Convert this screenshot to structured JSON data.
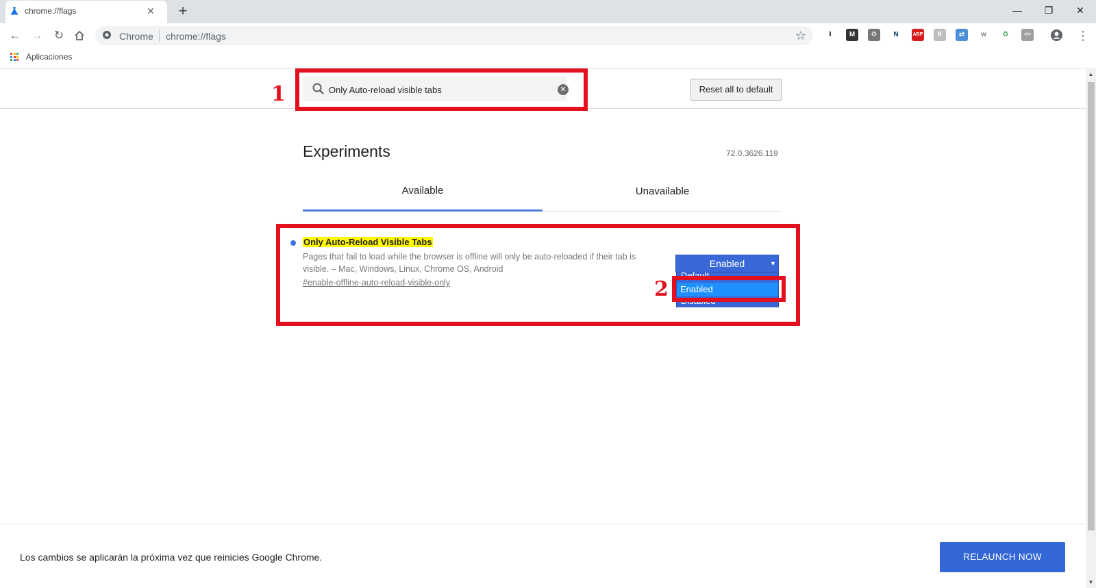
{
  "browser": {
    "tab": {
      "title": "chrome://flags",
      "favicon": "flask-icon",
      "close": "✕"
    },
    "new_tab": "+",
    "window": {
      "minimize": "—",
      "restore": "❐",
      "close": "✕"
    },
    "omnibox": {
      "site_label": "Chrome",
      "url": "chrome://flags"
    },
    "bookmarks": [
      {
        "label": "Aplicaciones",
        "icon": "apps-grid-icon"
      }
    ],
    "extensions": [
      {
        "name": "instapaper-icon",
        "glyph": "I",
        "color": "#ffffff",
        "fg": "#000000"
      },
      {
        "name": "mega-icon",
        "glyph": "M",
        "color": "#333333",
        "fg": "#ffffff"
      },
      {
        "name": "cog-extension-icon",
        "glyph": "⚙",
        "color": "#777777",
        "fg": "#ffffff"
      },
      {
        "name": "n-extension-icon",
        "glyph": "N",
        "color": "#ffffff",
        "fg": "#003a70"
      },
      {
        "name": "adblock-plus-icon",
        "glyph": "ABP",
        "color": "#d81b1b",
        "fg": "#ffffff"
      },
      {
        "name": "k-extension-icon",
        "glyph": "K",
        "color": "#bdbdbd",
        "fg": "#ffffff"
      },
      {
        "name": "translate-extension-icon",
        "glyph": "⇄",
        "color": "#4a90d9",
        "fg": "#ffffff"
      },
      {
        "name": "w-extension-icon",
        "glyph": "w",
        "color": "#ffffff",
        "fg": "#7a7a7a"
      },
      {
        "name": "recycle-extension-icon",
        "glyph": "♻",
        "color": "#ffffff",
        "fg": "#2e9b46"
      },
      {
        "name": "code-extension-icon",
        "glyph": "</>",
        "color": "#9e9e9e",
        "fg": "#ffffff"
      }
    ]
  },
  "flags": {
    "search_value": "Only Auto-reload visible tabs",
    "reset_label": "Reset all to default",
    "title": "Experiments",
    "version": "72.0.3626.119",
    "tabs": [
      "Available",
      "Unavailable"
    ],
    "experiment": {
      "name": "Only Auto-Reload Visible Tabs",
      "description": "Pages that fail to load while the browser is offline will only be auto-reloaded if their tab is visible. – Mac, Windows, Linux, Chrome OS, Android",
      "link": "#enable-offline-auto-reload-visible-only",
      "selected": "Enabled",
      "options": [
        "Default",
        "Enabled",
        "Disabled"
      ]
    }
  },
  "annotations": [
    "1",
    "2"
  ],
  "footer": {
    "message": "Los cambios se aplicarán la próxima vez que reinicies Google Chrome.",
    "relaunch_label": "RELAUNCH NOW"
  },
  "colors": {
    "accent": "#3367d6",
    "annotation": "#e3111f",
    "highlight": "#fefa00",
    "select_bg": "#3b68d8",
    "option_hover": "#1e90ff"
  }
}
